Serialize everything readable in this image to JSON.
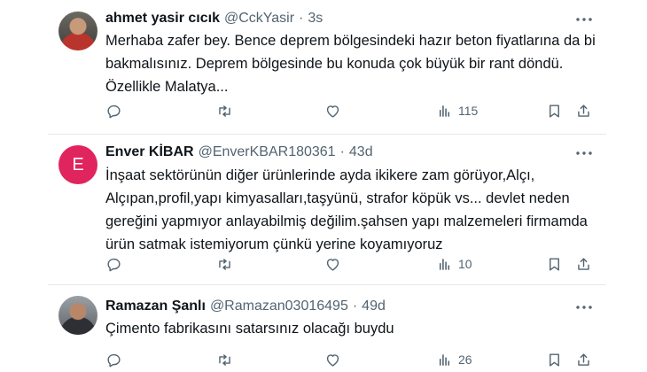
{
  "tweets": [
    {
      "name": "ahmet yasir cıcık",
      "handle": "@CckYasir",
      "separator": "·",
      "time": "3s",
      "lines": [
        "Merhaba zafer bey. Bence deprem bölgesindeki hazır beton fiyatlarına da bi",
        "bakmalısınız. Deprem bölgesinde bu konuda çok büyük bir rant döndü.",
        "Özellikle Malatya..."
      ],
      "views": "115",
      "avatar": "photo"
    },
    {
      "name": "Enver KİBAR",
      "handle": "@EnverKBAR180361",
      "separator": "·",
      "time": "43d",
      "avatar_letter": "E",
      "avatar_color": "#e0245e",
      "lines": [
        "İnşaat sektörünün diğer ürünlerinde ayda ikikere zam görüyor,Alçı,",
        "Alçıpan,profil,yapı kimyasalları,taşyünü, strafor köpük vs... devlet neden",
        "gereğini yapmıyor anlayabilmiş değilim.şahsen yapı malzemeleri firmamda",
        "ürün satmak istemiyorum çünkü yerine koyamıyoruz"
      ],
      "views": "10"
    },
    {
      "name": "Ramazan Şanlı",
      "handle": "@Ramazan03016495",
      "separator": "·",
      "time": "49d",
      "lines": [
        "Çimento fabrikasını satarsınız olacağı buydu"
      ],
      "views": "26",
      "avatar": "photo"
    }
  ],
  "icons": {
    "reply": "reply-icon",
    "retweet": "retweet-icon",
    "like": "like-icon",
    "views": "views-icon",
    "bookmark": "bookmark-icon",
    "share": "share-icon",
    "more": "more-icon"
  },
  "colors": {
    "text": "#0f1419",
    "secondary": "#536471",
    "divider": "#e7e9ea"
  }
}
